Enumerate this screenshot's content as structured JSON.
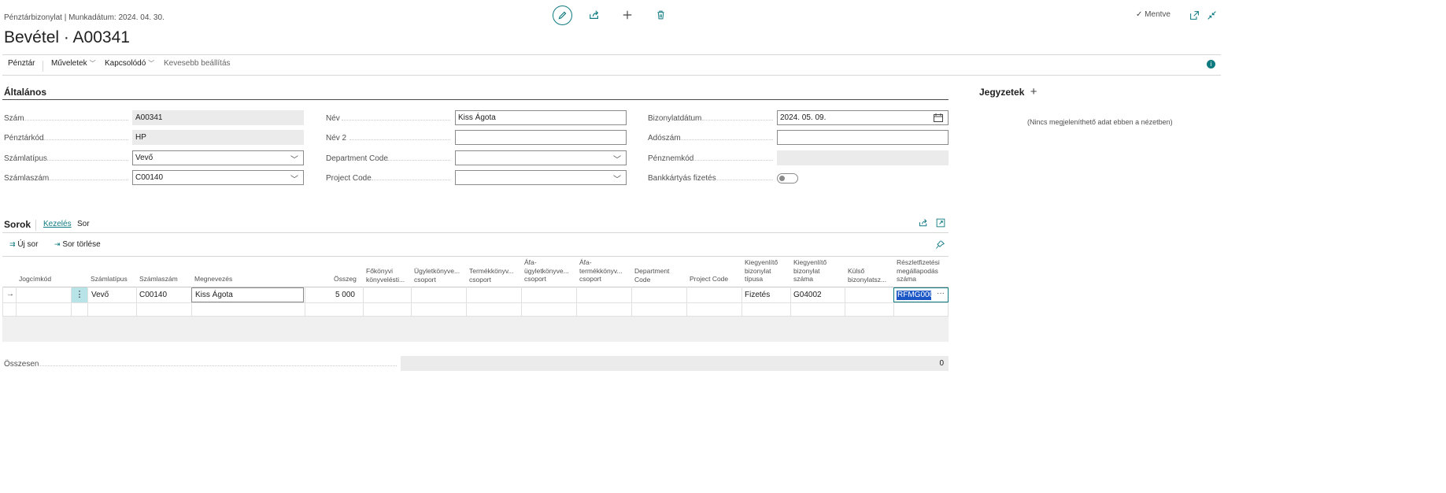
{
  "header": {
    "subtitle": "Pénztárbizonylat | Munkadátum: 2024. 04. 30.",
    "title": "Bevétel · A00341",
    "saved_label": "Mentve"
  },
  "toolbar": {
    "icons": [
      "edit-icon",
      "share-icon",
      "new-icon",
      "delete-icon"
    ],
    "right_icons": [
      "open-new-window-icon",
      "collapse-icon"
    ]
  },
  "actions": {
    "items": [
      "Pénztár",
      "Műveletek",
      "Kapcsolódó",
      "Kevesebb beállítás"
    ]
  },
  "general": {
    "title": "Általános",
    "col1": [
      {
        "label": "Szám",
        "value": "A00341"
      },
      {
        "label": "Pénztárkód",
        "value": "HP"
      },
      {
        "label": "Számlatípus",
        "value": "Vevő"
      },
      {
        "label": "Számlaszám",
        "value": "C00140"
      }
    ],
    "col2": [
      {
        "label": "Név",
        "value": "Kiss Ágota"
      },
      {
        "label": "Név 2",
        "value": ""
      },
      {
        "label": "Department Code",
        "value": ""
      },
      {
        "label": "Project Code",
        "value": ""
      }
    ],
    "col3": [
      {
        "label": "Bizonylatdátum",
        "value": "2024. 05. 09."
      },
      {
        "label": "Adószám",
        "value": ""
      },
      {
        "label": "Pénznemkód",
        "value": ""
      },
      {
        "label": "Bankkártyás fizetés",
        "value": ""
      }
    ]
  },
  "notes": {
    "title": "Jegyzetek",
    "empty": "(Nincs megjeleníthető adat ebben a nézetben)"
  },
  "lines": {
    "title": "Sorok",
    "tabs": [
      "Kezelés",
      "Sor"
    ],
    "new_line": "Új sor",
    "delete_line": "Sor törlése",
    "columns": [
      "Jogcímkód",
      "Számlatípus",
      "Számlaszám",
      "Megnevezés",
      "Összeg",
      "Főkönyvi könyvelésti...",
      "Ügyletkönyve... csoport",
      "Termékkönyv... csoport",
      "Áfa-ügyletkönyve... csoport",
      "Áfa-termékkönyv... csoport",
      "Department Code",
      "Project Code",
      "Kiegyenlítő bizonylat típusa",
      "Kiegyenlítő bizonylat száma",
      "Külső bizonylatsz...",
      "Részletfizetési megállapodás száma"
    ],
    "row": {
      "jogcimkod": "",
      "szamlatipus": "Vevő",
      "szamlaszam": "C00140",
      "megnevezes": "Kiss Ágota",
      "osszeg": "5 000",
      "kiegy_tipus": "Fizetés",
      "kiegy_szam": "G04002",
      "reszlet": "RFMG0000"
    }
  },
  "total": {
    "label": "Összesen",
    "value": "0"
  }
}
